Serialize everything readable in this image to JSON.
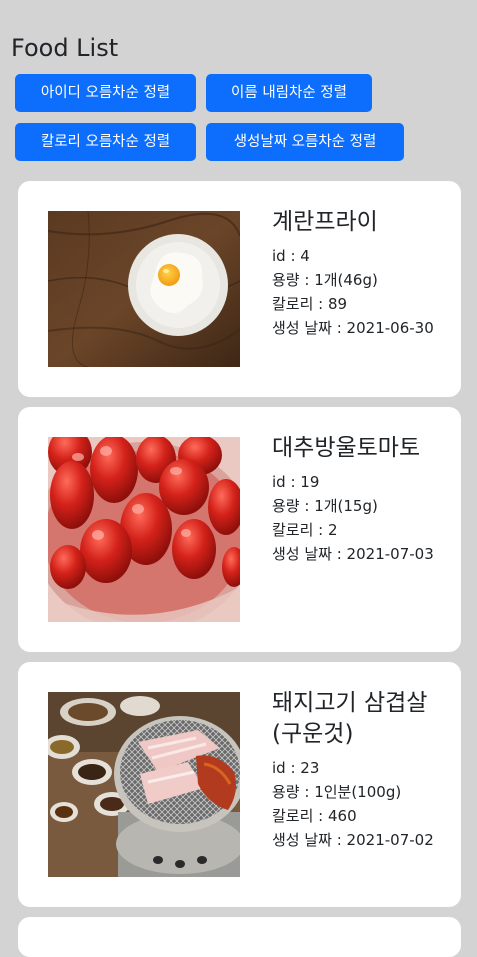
{
  "page": {
    "title": "Food List"
  },
  "sort_buttons": {
    "by_id": "아이디 오름차순 정렬",
    "by_name": "이름 내림차순 정렬",
    "by_calorie": "칼로리 오름차순 정렬",
    "by_created": "생성날짜 오름차순 정렬"
  },
  "foods": [
    {
      "name": "계란프라이",
      "id": "id : 4",
      "serving": "용량 : 1개(46g)",
      "calorie": "칼로리 : 89",
      "created": "생성 날짜 : 2021-06-30",
      "image": "fried-egg-photo"
    },
    {
      "name": "대추방울토마토",
      "id": "id : 19",
      "serving": "용량 : 1개(15g)",
      "calorie": "칼로리 : 2",
      "created": "생성 날짜 : 2021-07-03",
      "image": "cherry-tomato-photo"
    },
    {
      "name": "돼지고기 삼겹살(구운것)",
      "id": "id : 23",
      "serving": "용량 : 1인분(100g)",
      "calorie": "칼로리 : 460",
      "created": "생성 날짜 : 2021-07-02",
      "image": "grilled-pork-belly-photo"
    }
  ],
  "colors": {
    "background": "#d3d3d3",
    "button": "#0d6efd",
    "card": "#ffffff",
    "text": "#212529"
  }
}
